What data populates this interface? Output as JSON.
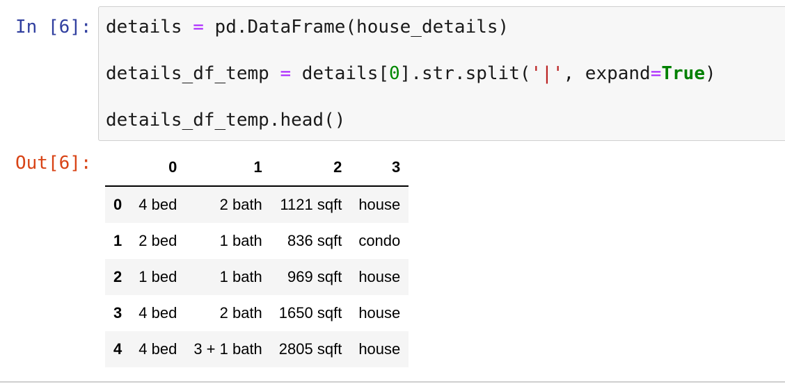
{
  "cell": {
    "in_prompt": "In [6]:",
    "out_prompt": "Out[6]:",
    "code": {
      "line1": {
        "var": "details",
        "eq": "=",
        "call": "pd.DataFrame(house_details)"
      },
      "line2": {
        "var": "details_df_temp",
        "eq": "=",
        "pre": "details[",
        "index": "0",
        "mid": "].str.split(",
        "sep": "'|'",
        "comma": ", expand",
        "eq2": "=",
        "kw": "True",
        "close": ")"
      },
      "line3": "details_df_temp.head()"
    }
  },
  "table": {
    "columns": [
      "",
      "0",
      "1",
      "2",
      "3"
    ],
    "rows": [
      {
        "index": "0",
        "cells": [
          "4 bed",
          "2 bath",
          "1121 sqft",
          "house"
        ]
      },
      {
        "index": "1",
        "cells": [
          "2 bed",
          "1 bath",
          "836 sqft",
          "condo"
        ]
      },
      {
        "index": "2",
        "cells": [
          "1 bed",
          "1 bath",
          "969 sqft",
          "house"
        ]
      },
      {
        "index": "3",
        "cells": [
          "4 bed",
          "2 bath",
          "1650 sqft",
          "house"
        ]
      },
      {
        "index": "4",
        "cells": [
          "4 bed",
          "3 + 1 bath",
          "2805 sqft",
          "house"
        ]
      }
    ]
  },
  "colors": {
    "in_prompt": "#303f9f",
    "out_prompt": "#d84315",
    "code_bg": "#f7f7f7",
    "operator": "#aa22ff",
    "number": "#008800",
    "string": "#ba2121",
    "keyword": "#008000"
  }
}
